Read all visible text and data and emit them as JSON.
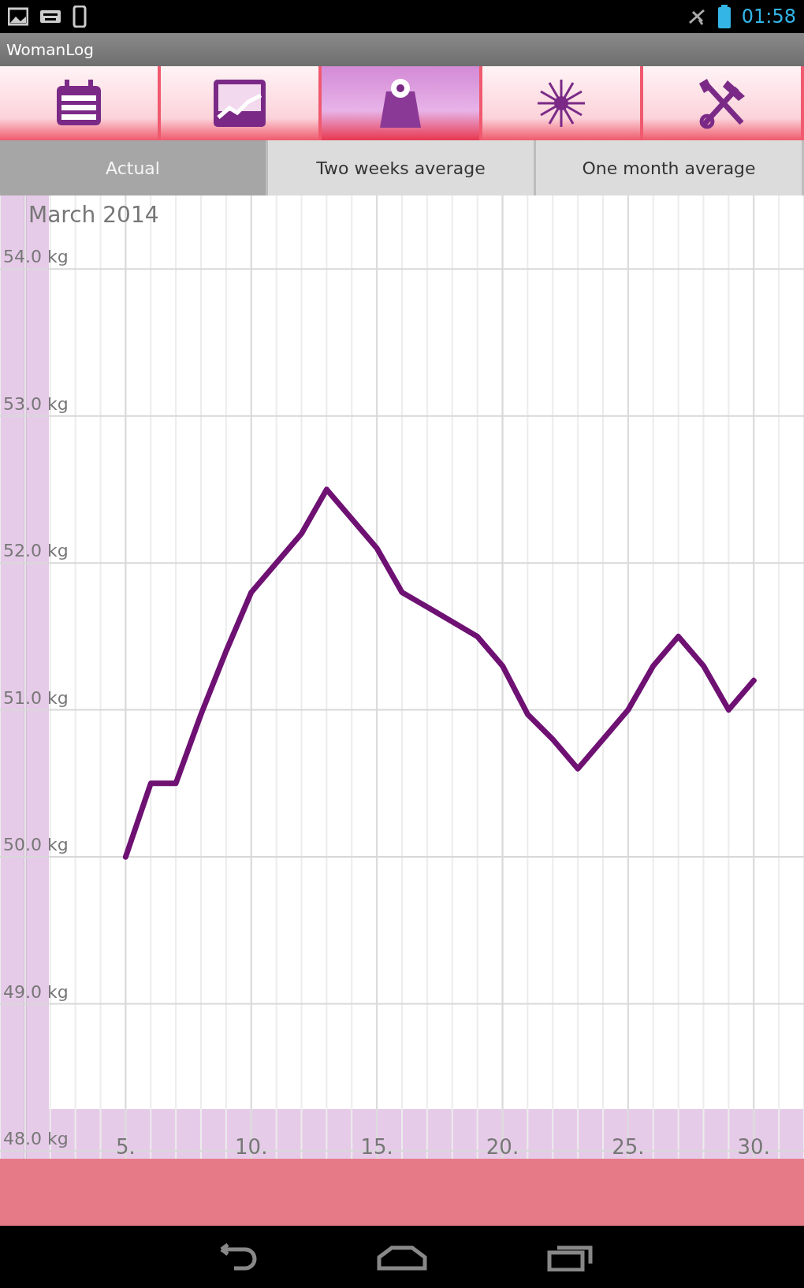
{
  "status_bar": {
    "time": "01:58"
  },
  "window": {
    "title": "WomanLog"
  },
  "nav_items": [
    {
      "selected": false
    },
    {
      "selected": false
    },
    {
      "selected": true
    },
    {
      "selected": false
    },
    {
      "selected": false
    }
  ],
  "tabs": [
    {
      "label": "Actual",
      "selected": true
    },
    {
      "label": "Two weeks average",
      "selected": false
    },
    {
      "label": "One month average",
      "selected": false
    }
  ],
  "chart": {
    "chart_data": {
      "type": "line",
      "title": "March 2014",
      "x": [
        5,
        6,
        7,
        8,
        9,
        10,
        11,
        12,
        13,
        14,
        15,
        16,
        17,
        18,
        19,
        20,
        21,
        22,
        23,
        24,
        25,
        26,
        27,
        28,
        29,
        30
      ],
      "series": [
        {
          "color": "#6e1173",
          "values": [
            50.0,
            50.5,
            50.5,
            50.97,
            51.4,
            51.8,
            52.0,
            52.2,
            52.5,
            52.3,
            52.1,
            51.8,
            51.7,
            51.6,
            51.5,
            51.3,
            50.97,
            50.8,
            50.6,
            50.8,
            51.0,
            51.3,
            51.5,
            51.3,
            51.0,
            51.2
          ]
        }
      ],
      "xlim": [
        0,
        32
      ],
      "ylim": [
        48,
        54.5
      ],
      "grid": true,
      "xticks": [
        {
          "value": 5,
          "label": "5."
        },
        {
          "value": 10,
          "label": "10."
        },
        {
          "value": 15,
          "label": "15."
        },
        {
          "value": 20,
          "label": "20."
        },
        {
          "value": 25,
          "label": "25."
        },
        {
          "value": 30,
          "label": "30."
        }
      ],
      "yticks": [
        {
          "value": 48,
          "label": "48.0 kg"
        },
        {
          "value": 49,
          "label": "49.0 kg"
        },
        {
          "value": 50,
          "label": "50.0 kg"
        },
        {
          "value": 51,
          "label": "51.0 kg"
        },
        {
          "value": 52,
          "label": "52.0 kg"
        },
        {
          "value": 53,
          "label": "53.0 kg"
        },
        {
          "value": 54,
          "label": "54.0 kg"
        }
      ]
    }
  }
}
